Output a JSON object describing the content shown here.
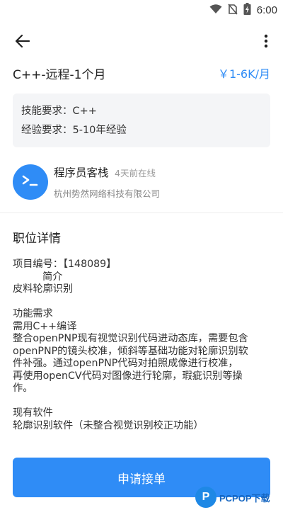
{
  "status_bar": {
    "time": "6:00",
    "icons": [
      "wifi-icon",
      "no-sim-icon",
      "battery-charging-icon"
    ]
  },
  "app_bar": {
    "back_icon": "arrow-left-icon",
    "more_icon": "more-vert-icon"
  },
  "job": {
    "title": "C++-远程-1个月",
    "salary": "￥1-6K/月"
  },
  "requirements": {
    "skill_label": "技能要求：",
    "skill_value": "C++",
    "experience_label": "经验要求：",
    "experience_value": "5-10年经验"
  },
  "company": {
    "avatar_icon": "terminal-icon",
    "recruiter_name": "程序员客栈",
    "online_status": "4天前在线",
    "company_name": "杭州势然网络科技有限公司"
  },
  "details": {
    "section_title": "职位详情",
    "project_id_line": "项目编号：【148089】",
    "intro_label": "简介",
    "intro_text": "皮料轮廓识别",
    "function_label": "功能需求",
    "function_lines": [
      "需用C++编译",
      "整合openPNP现有视觉识别代码进动态库，需要包含",
      "openPNP的镜头校准，倾斜等基础功能对轮廓识别软",
      "件补强。通过openPNP代码对拍照成像进行校准，",
      "再使用openCV代码对图像进行轮廓，瑕疵识别等操",
      "作。"
    ],
    "software_label": "现有软件",
    "software_text": "轮廓识别软件（未整合视觉识别校正功能）"
  },
  "actions": {
    "apply_label": "申请接单"
  },
  "watermark": {
    "logo_letter": "P",
    "text": "PCPOP下载"
  },
  "colors": {
    "accent": "#2f8cf6",
    "info_box_bg": "#f4f5f7"
  }
}
